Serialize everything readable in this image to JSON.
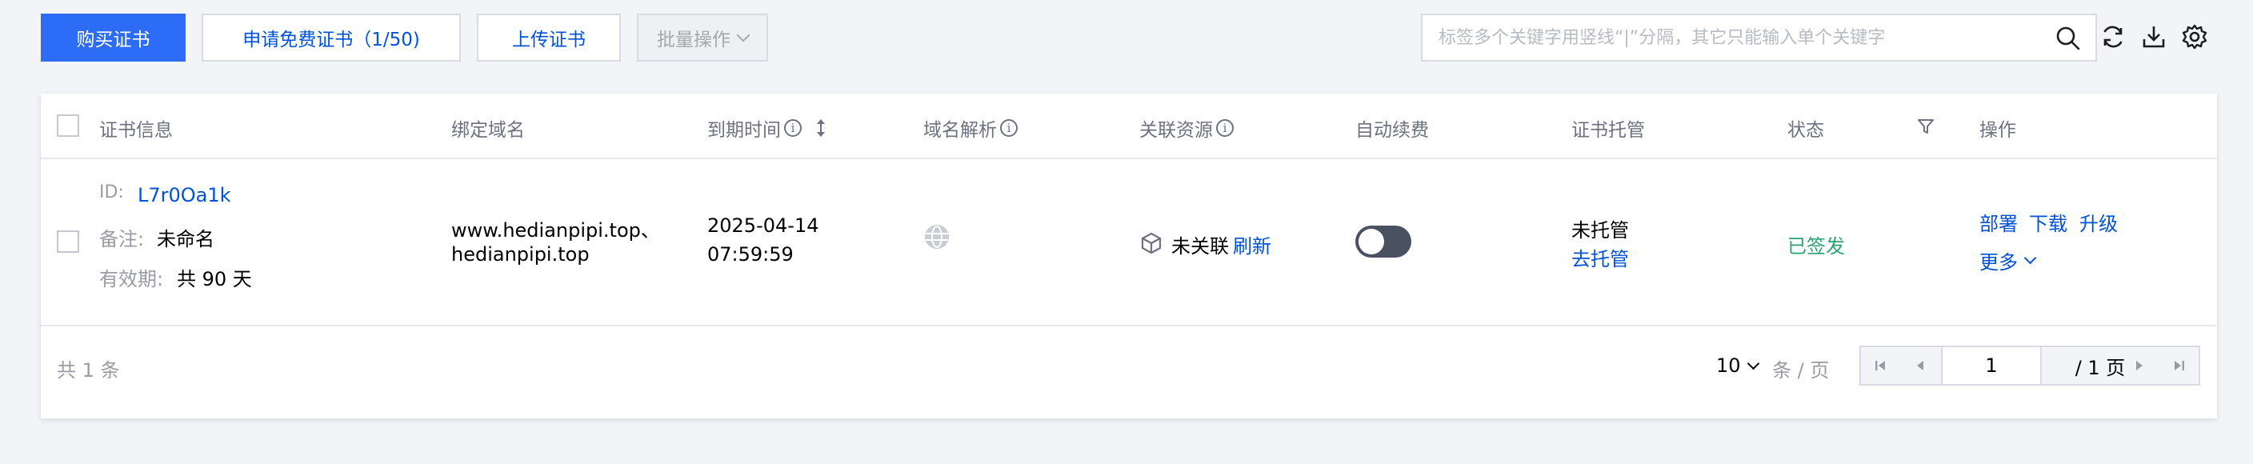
{
  "toolbar": {
    "buy_label": "购买证书",
    "apply_free_label": "申请免费证书（1/50)",
    "upload_label": "上传证书",
    "batch_label": "批量操作"
  },
  "search": {
    "placeholder": "标签多个关键字用竖线“|”分隔，其它只能输入单个关键字",
    "value": ""
  },
  "toolbar_icons": [
    "search-icon",
    "refresh-icon",
    "download-icon",
    "settings-icon"
  ],
  "table": {
    "headers": {
      "cert_info": "证书信息",
      "domain": "绑定域名",
      "expiry": "到期时间",
      "dns": "域名解析",
      "resource": "关联资源",
      "auto_renew": "自动续费",
      "hosting": "证书托管",
      "status": "状态",
      "actions": "操作"
    },
    "rows": [
      {
        "id_label": "ID:",
        "id_value": "L7r0Oa1k",
        "remark_label": "备注:",
        "remark_value": "未命名",
        "validity_label": "有效期:",
        "validity_value": "共 90 天",
        "domain_line1": "www.hedianpipi.top、",
        "domain_line2": "hedianpipi.top",
        "expiry_date": "2025-04-14",
        "expiry_time": "07:59:59",
        "resource_text": "未关联",
        "resource_refresh": "刷新",
        "auto_renew": false,
        "hosting_text": "未托管",
        "hosting_link": "去托管",
        "status": "已签发",
        "action_deploy": "部署",
        "action_download": "下载",
        "action_upgrade": "升级",
        "action_more": "更多"
      }
    ]
  },
  "footer": {
    "total": "共 1 条",
    "page_size": "10",
    "page_size_unit": "条 / 页",
    "current_page": "1",
    "total_pages": "/ 1 页"
  },
  "colors": {
    "primary": "#2d6cf6",
    "link": "#0052d9",
    "success": "#2ba471"
  }
}
